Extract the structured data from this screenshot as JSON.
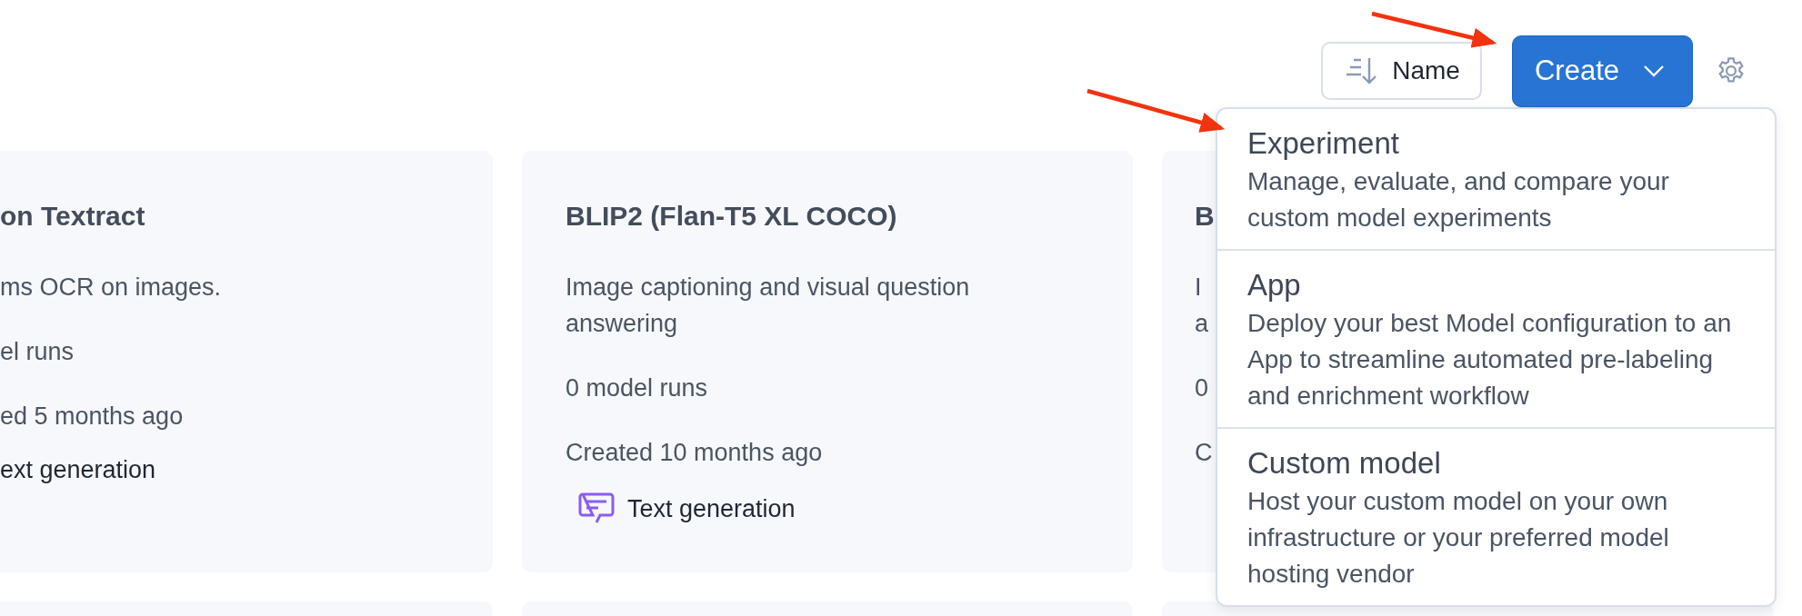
{
  "toolbar": {
    "sort_button": "Name",
    "create_button": "Create"
  },
  "cards": [
    {
      "kind": "cut-left",
      "title": "on Textract",
      "description_lines": [
        "ms OCR on images."
      ],
      "runs": "el runs",
      "created": "ed 5 months ago",
      "tag": {
        "kind": "text-generation",
        "label": "ext generation"
      }
    },
    {
      "kind": "full",
      "title": "BLIP2 (Flan-T5 XL COCO)",
      "description_lines": [
        "Image captioning and visual question",
        "answering"
      ],
      "runs": "0 model runs",
      "created": "Created 10 months ago",
      "tag": {
        "kind": "text-generation",
        "label": "Text generation"
      }
    },
    {
      "kind": "cut-right",
      "title": "B",
      "description_lines": [
        "I",
        "a"
      ],
      "runs": "0",
      "created": "C"
    }
  ],
  "create_menu": [
    {
      "title": "Experiment",
      "description_lines": [
        "Manage, evaluate, and compare your",
        "custom model experiments"
      ]
    },
    {
      "title": "App",
      "description_lines": [
        "Deploy your best Model configuration to an",
        "App to streamline automated pre-labeling",
        "and enrichment workflow"
      ]
    },
    {
      "title": "Custom model",
      "description_lines": [
        "Host your custom model on your own",
        "infrastructure or your preferred model",
        "hosting vendor"
      ]
    }
  ]
}
